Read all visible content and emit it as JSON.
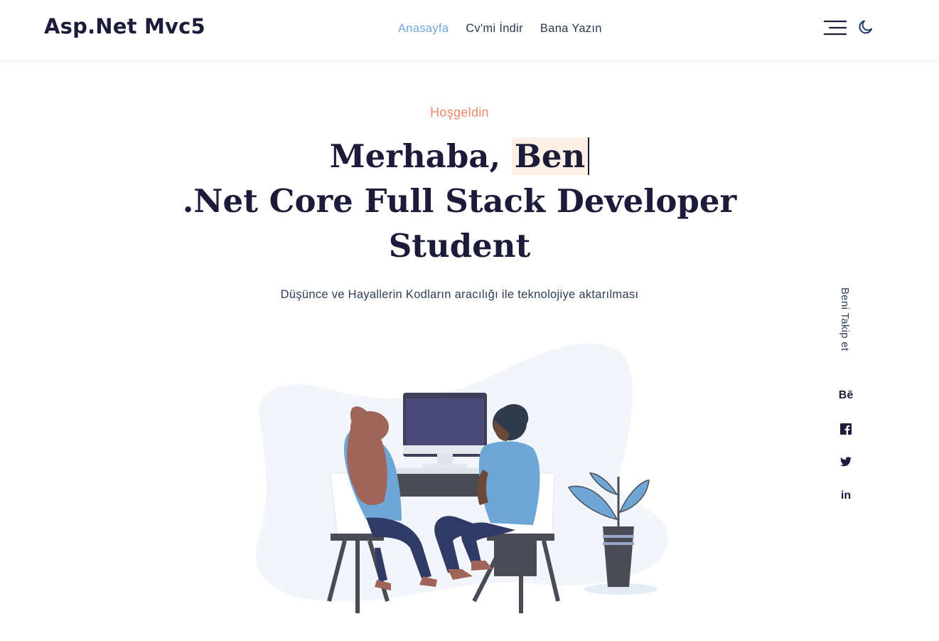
{
  "header": {
    "brand": "Asp.Net Mvc5",
    "nav": [
      {
        "label": "Anasayfa",
        "active": true
      },
      {
        "label": "Cv'mi İndir",
        "active": false
      },
      {
        "label": "Bana Yazın",
        "active": false
      }
    ],
    "icons": [
      "hamburger-menu-icon",
      "moon-icon"
    ]
  },
  "hero": {
    "greeting": "Hoşgeldin",
    "title_prefix": "Merhaba,",
    "title_highlight": "Ben",
    "title_line2": ".Net Core Full Stack Developer",
    "title_line3": "Student",
    "description": "Düşünce ve Hayallerin Kodların aracılığı ile teknolojiye aktarılması",
    "illustration": "two-people-at-computer-illustration"
  },
  "social": {
    "label": "Beni Takip et",
    "items": [
      {
        "icon": "behance-icon",
        "text": "Bē"
      },
      {
        "icon": "facebook-icon"
      },
      {
        "icon": "twitter-icon"
      },
      {
        "icon": "linkedin-icon",
        "text": "in"
      }
    ]
  },
  "colors": {
    "accent_nav": "#6ea7d6",
    "greeting": "#f0886c",
    "title": "#1c1c3a",
    "highlight_bg": "#fdf0e7"
  }
}
